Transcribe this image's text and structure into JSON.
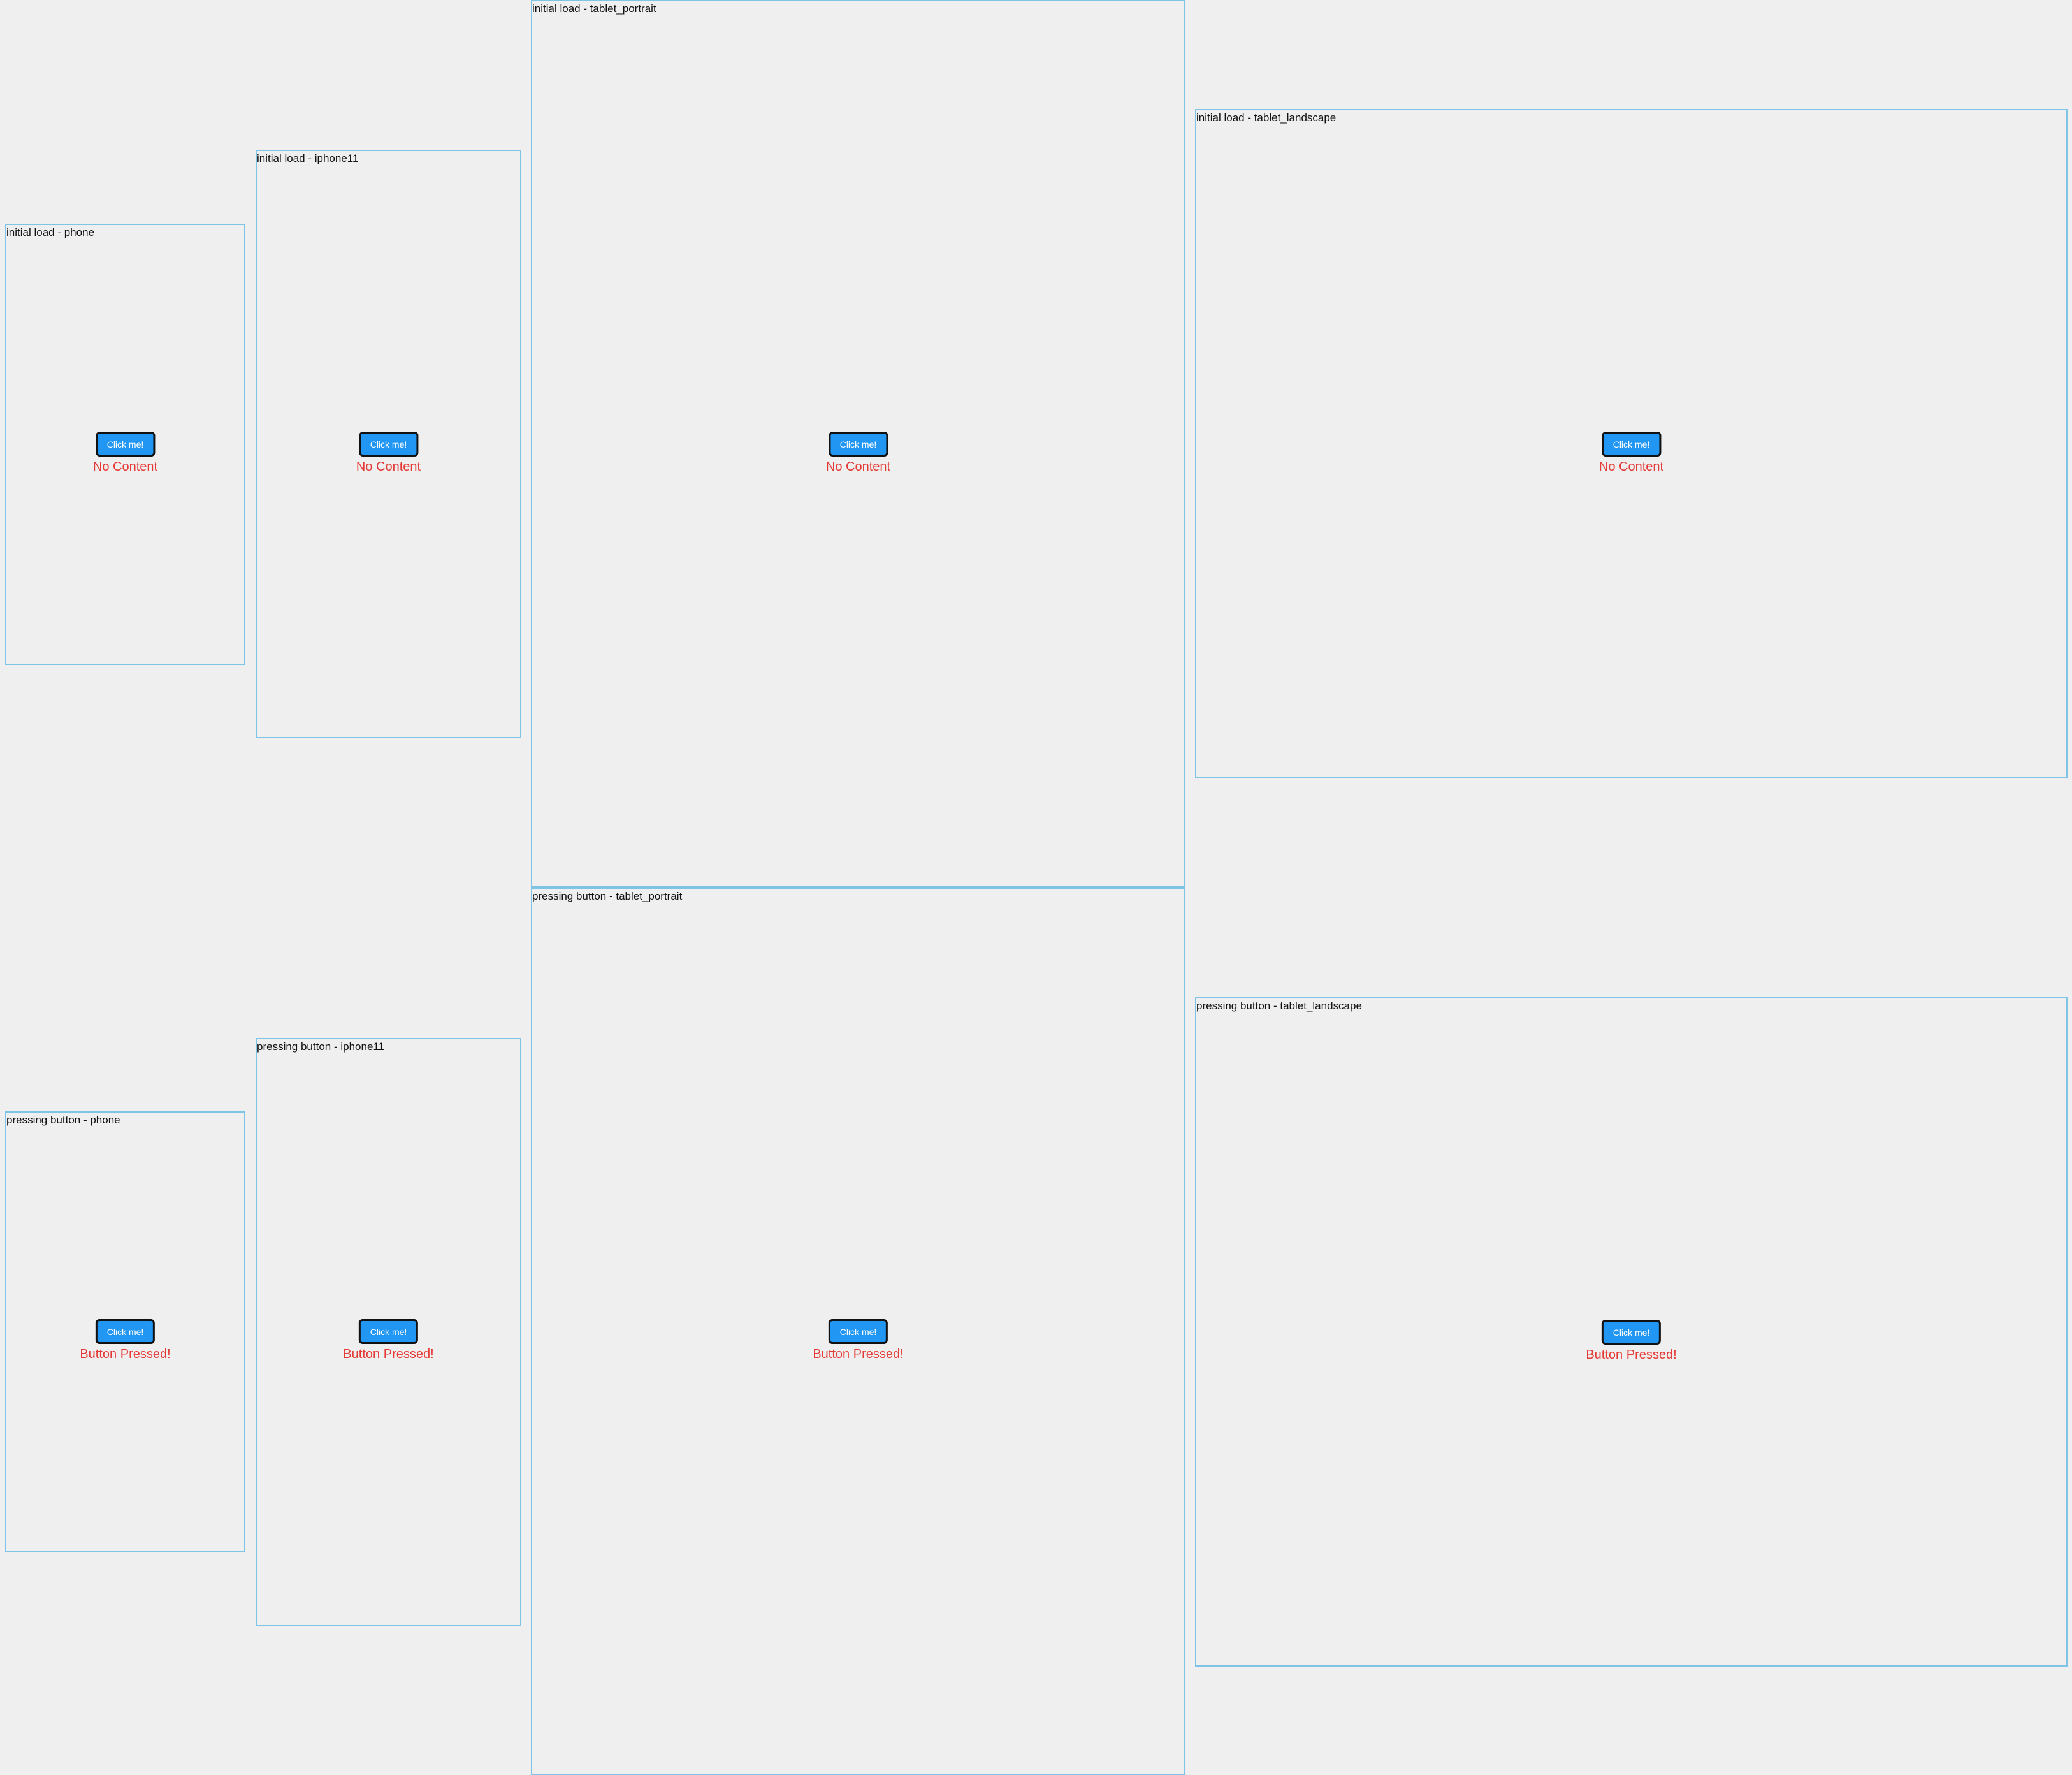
{
  "accent_color": "#2196f3",
  "status_color": "#e53935",
  "frame_border_color": "#7fc4e6",
  "frames": [
    {
      "label": "initial load - phone",
      "button_label": "Click me!",
      "status": "No Content"
    },
    {
      "label": "initial load - iphone11",
      "button_label": "Click me!",
      "status": "No Content"
    },
    {
      "label": "initial load - tablet_portrait",
      "button_label": "Click me!",
      "status": "No Content"
    },
    {
      "label": "initial load - tablet_landscape",
      "button_label": "Click me!",
      "status": "No Content"
    },
    {
      "label": "pressing button - phone",
      "button_label": "Click me!",
      "status": "Button Pressed!"
    },
    {
      "label": "pressing button - iphone11",
      "button_label": "Click me!",
      "status": "Button Pressed!"
    },
    {
      "label": "pressing button - tablet_portrait",
      "button_label": "Click me!",
      "status": "Button Pressed!"
    },
    {
      "label": "pressing button - tablet_landscape",
      "button_label": "Click me!",
      "status": "Button Pressed!"
    }
  ]
}
